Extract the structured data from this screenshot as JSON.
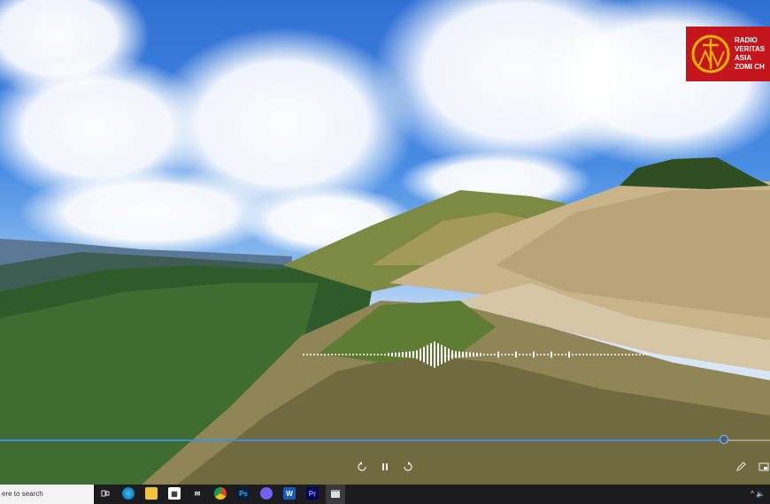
{
  "logo": {
    "line1": "RADIO",
    "line2": "VERITAS",
    "line3": "ASIA",
    "line4": "ZOMI CH",
    "color": "#c4161c"
  },
  "player": {
    "progress": 0.94,
    "accent": "#3a8ee6",
    "controls": {
      "back_icon": "rewind-10-icon",
      "pause_icon": "pause-icon",
      "forward_icon": "forward-30-icon",
      "edit_icon": "pencil-icon",
      "fullscreen_icon": "miniplayer-icon"
    }
  },
  "taskbar": {
    "search_placeholder": "ere to search",
    "icons": [
      "task-view-icon",
      "edge-icon",
      "file-explorer-icon",
      "calendar-icon",
      "mail-icon",
      "chrome-icon",
      "photoshop-icon",
      "viber-icon",
      "word-icon",
      "premiere-icon",
      "video-editor-icon"
    ],
    "ps_label": "Ps",
    "pr_label": "Pr",
    "word_label": "W",
    "tray": "^ 🔈"
  }
}
